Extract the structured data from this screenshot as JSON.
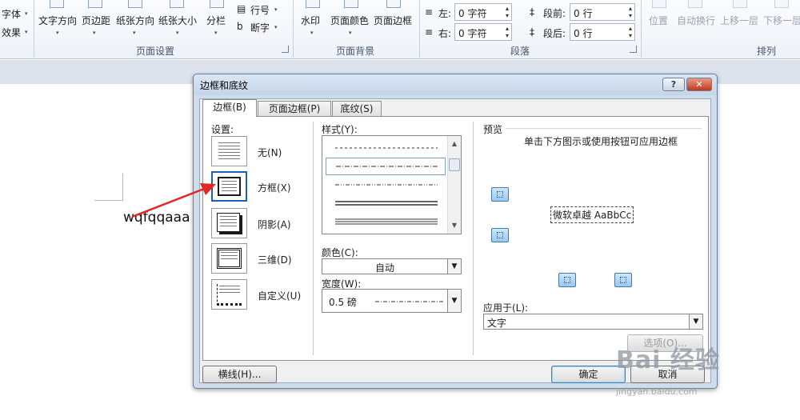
{
  "ribbon": {
    "font_label": "字体",
    "effects_label": "效果",
    "text_direction": "文字方向",
    "margins": "页边距",
    "orientation": "纸张方向",
    "paper_size": "纸张大小",
    "columns": "分栏",
    "line_numbers": "行号",
    "hyphenation": "断字",
    "page_setup_group": "页面设置",
    "watermark": "水印",
    "page_color": "页面颜色",
    "page_border": "页面边框",
    "page_background_group": "页面背景",
    "indent_left_label": "左:",
    "indent_left_value": "0 字符",
    "indent_right_label": "右:",
    "indent_right_value": "0 字符",
    "spacing_before_label": "段前:",
    "spacing_before_value": "0 行",
    "spacing_after_label": "段后:",
    "spacing_after_value": "0 行",
    "paragraph_group": "段落",
    "position": "位置",
    "wrap_text": "自动换行",
    "bring_forward": "上移一层",
    "send_backward": "下移一层",
    "arrange_group": "排列"
  },
  "document": {
    "text": "wqfqqaaa"
  },
  "dialog": {
    "title": "边框和底纹",
    "help": "?",
    "close": "✕",
    "tabs": [
      "边框(B)",
      "页面边框(P)",
      "底纹(S)"
    ],
    "settings_label": "设置:",
    "settings": [
      "无(N)",
      "方框(X)",
      "阴影(A)",
      "三维(D)",
      "自定义(U)"
    ],
    "style_label": "样式(Y):",
    "color_label": "颜色(C):",
    "color_value": "自动",
    "width_label": "宽度(W):",
    "width_value": "0.5 磅",
    "preview_label": "预览",
    "preview_hint": "单击下方图示或使用按钮可应用边框",
    "preview_sample": "微软卓越 AaBbCc",
    "apply_to_label": "应用于(L):",
    "apply_to_value": "文字",
    "options_button": "选项(O)...",
    "horizontal_line_button": "横线(H)...",
    "ok_button": "确定",
    "cancel_button": "取消"
  },
  "watermark": {
    "logo": "Bai 经验",
    "url": "jingyan.baidu.com"
  }
}
